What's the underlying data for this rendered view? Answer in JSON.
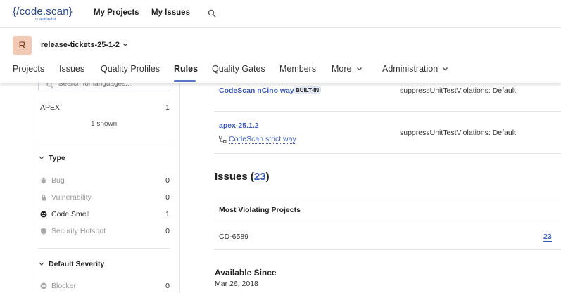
{
  "topbar": {
    "logo": "{/code.scan}",
    "logo_sub_prefix": "by",
    "logo_sub_brand": "autorabit",
    "nav": [
      "My Projects",
      "My Issues"
    ]
  },
  "project": {
    "avatar_letter": "R",
    "name": "release-tickets-25-1-2"
  },
  "tabs": [
    "Projects",
    "Issues",
    "Quality Profiles",
    "Rules",
    "Quality Gates",
    "Members",
    "More",
    "Administration"
  ],
  "active_tab": "Rules",
  "sidebar": {
    "search_placeholder": "Search for languages...",
    "languages": [
      {
        "label": "APEX",
        "count": "1"
      }
    ],
    "shown_text": "1 shown",
    "type_facet": {
      "title": "Type",
      "items": [
        {
          "label": "Bug",
          "count": "0",
          "icon": "bug-icon"
        },
        {
          "label": "Vulnerability",
          "count": "0",
          "icon": "lock-icon"
        },
        {
          "label": "Code Smell",
          "count": "1",
          "icon": "code-smell-icon"
        },
        {
          "label": "Security Hotspot",
          "count": "0",
          "icon": "shield-icon"
        }
      ]
    },
    "severity_facet": {
      "title": "Default Severity",
      "items": [
        {
          "label": "Blocker",
          "count": "0",
          "icon": "blocker-icon"
        }
      ]
    }
  },
  "main": {
    "profiles": [
      {
        "name": "CodeScan nCino way",
        "badge": "BUILT-IN",
        "param": "suppressUnitTestViolations: Default"
      },
      {
        "name": "apex-25.1.2",
        "parent": "CodeScan strict way",
        "param": "suppressUnitTestViolations: Default"
      }
    ],
    "issues_label": "Issues",
    "issues_open": "(",
    "issues_count": "23",
    "issues_close": ")",
    "most_violating_title": "Most Violating Projects",
    "violating_projects": [
      {
        "name": "CD-6589",
        "count": "23"
      }
    ],
    "available_since_title": "Available Since",
    "available_since_date": "Mar 26, 2018"
  },
  "colors": {
    "link": "#3b5bb5",
    "accent": "#5b72cc",
    "avatar_bg": "#f1c9b4"
  }
}
